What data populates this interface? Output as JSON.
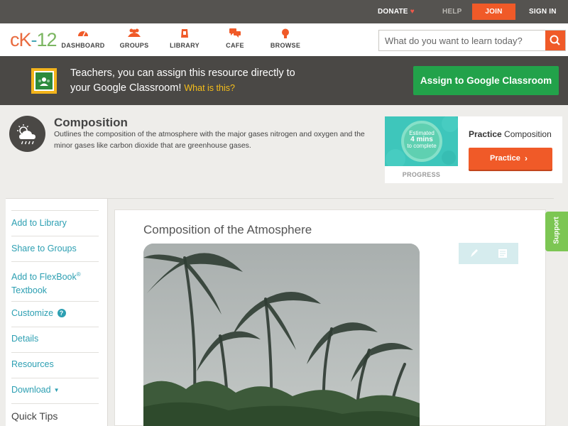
{
  "topbar": {
    "donate": "DONATE",
    "help": "HELP",
    "join": "JOIN",
    "signin": "SIGN IN"
  },
  "nav": {
    "logo": {
      "part1": "cK",
      "part2": "-",
      "part3": "12"
    },
    "items": [
      {
        "label": "DASHBOARD",
        "icon": "dashboard-icon"
      },
      {
        "label": "GROUPS",
        "icon": "groups-icon"
      },
      {
        "label": "LIBRARY",
        "icon": "library-icon"
      },
      {
        "label": "CAFE",
        "icon": "cafe-icon"
      },
      {
        "label": "BROWSE",
        "icon": "browse-icon"
      }
    ],
    "search_placeholder": "What do you want to learn today?"
  },
  "classroom_banner": {
    "line1": "Teachers, you can assign this resource directly to",
    "line2": "your Google Classroom!",
    "what_link": "What is this?",
    "button": "Assign to Google Classroom"
  },
  "concept": {
    "title": "Composition",
    "description": "Outlines the composition of the atmosphere with the major gases nitrogen and oxygen and the minor gases like carbon dioxide that are greenhouse gases."
  },
  "practice_card": {
    "estimate_line1": "Estimated",
    "estimate_line2": "4 mins",
    "estimate_line3": "to complete",
    "progress_label": "PROGRESS",
    "label_bold": "Practice",
    "label_rest": "Composition",
    "button": "Practice"
  },
  "sidebar": {
    "add_to_library": "Add to Library",
    "share_to_groups": "Share to Groups",
    "add_to_flexbook_1": "Add to FlexBook",
    "add_to_flexbook_reg": "®",
    "add_to_flexbook_2": "Textbook",
    "customize": "Customize",
    "customize_help": "?",
    "details": "Details",
    "resources": "Resources",
    "download": "Download",
    "quick_tips": "Quick Tips"
  },
  "article": {
    "title": "Composition of the Atmosphere"
  },
  "support_tab": "Support",
  "colors": {
    "brand_orange": "#f05a28",
    "teal_link": "#2c9fb2",
    "classroom_green": "#22a24a",
    "support_green": "#7cc653"
  }
}
